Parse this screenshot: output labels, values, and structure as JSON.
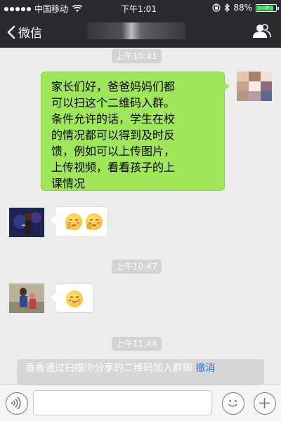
{
  "status_bar": {
    "carrier": "中国移动",
    "time": "下午1:01",
    "battery_percent": "88%",
    "battery_level": 0.88
  },
  "nav": {
    "back_label": "微信"
  },
  "messages": [
    {
      "type": "timestamp",
      "text": "上午10:41"
    },
    {
      "type": "outgoing",
      "lines": [
        "家长们好，爸爸妈妈们都",
        "可以扫这个二维码入群。",
        "条件允许的话，学生在校",
        "的情况都可以得到及时反",
        "馈，例如可以上传图片，",
        "上传视频，看看孩子的上",
        "课情况"
      ]
    },
    {
      "type": "incoming",
      "content": [
        "blush-emoji",
        "blush-emoji"
      ]
    },
    {
      "type": "timestamp",
      "text": "上午10:47"
    },
    {
      "type": "incoming",
      "content": [
        "smile-emoji"
      ]
    },
    {
      "type": "timestamp",
      "text": "上午11:44"
    },
    {
      "type": "system",
      "text": "香香通过扫描你分享的二维码加入群聊",
      "action": "撤消"
    }
  ],
  "input_bar": {
    "value": "",
    "icons": [
      "voice-icon",
      "emoji-icon",
      "plus-icon"
    ]
  },
  "colors": {
    "bar": "#2b2b2f",
    "outgoing_bubble": "#9fe658",
    "revoke_link": "#3478c8"
  }
}
